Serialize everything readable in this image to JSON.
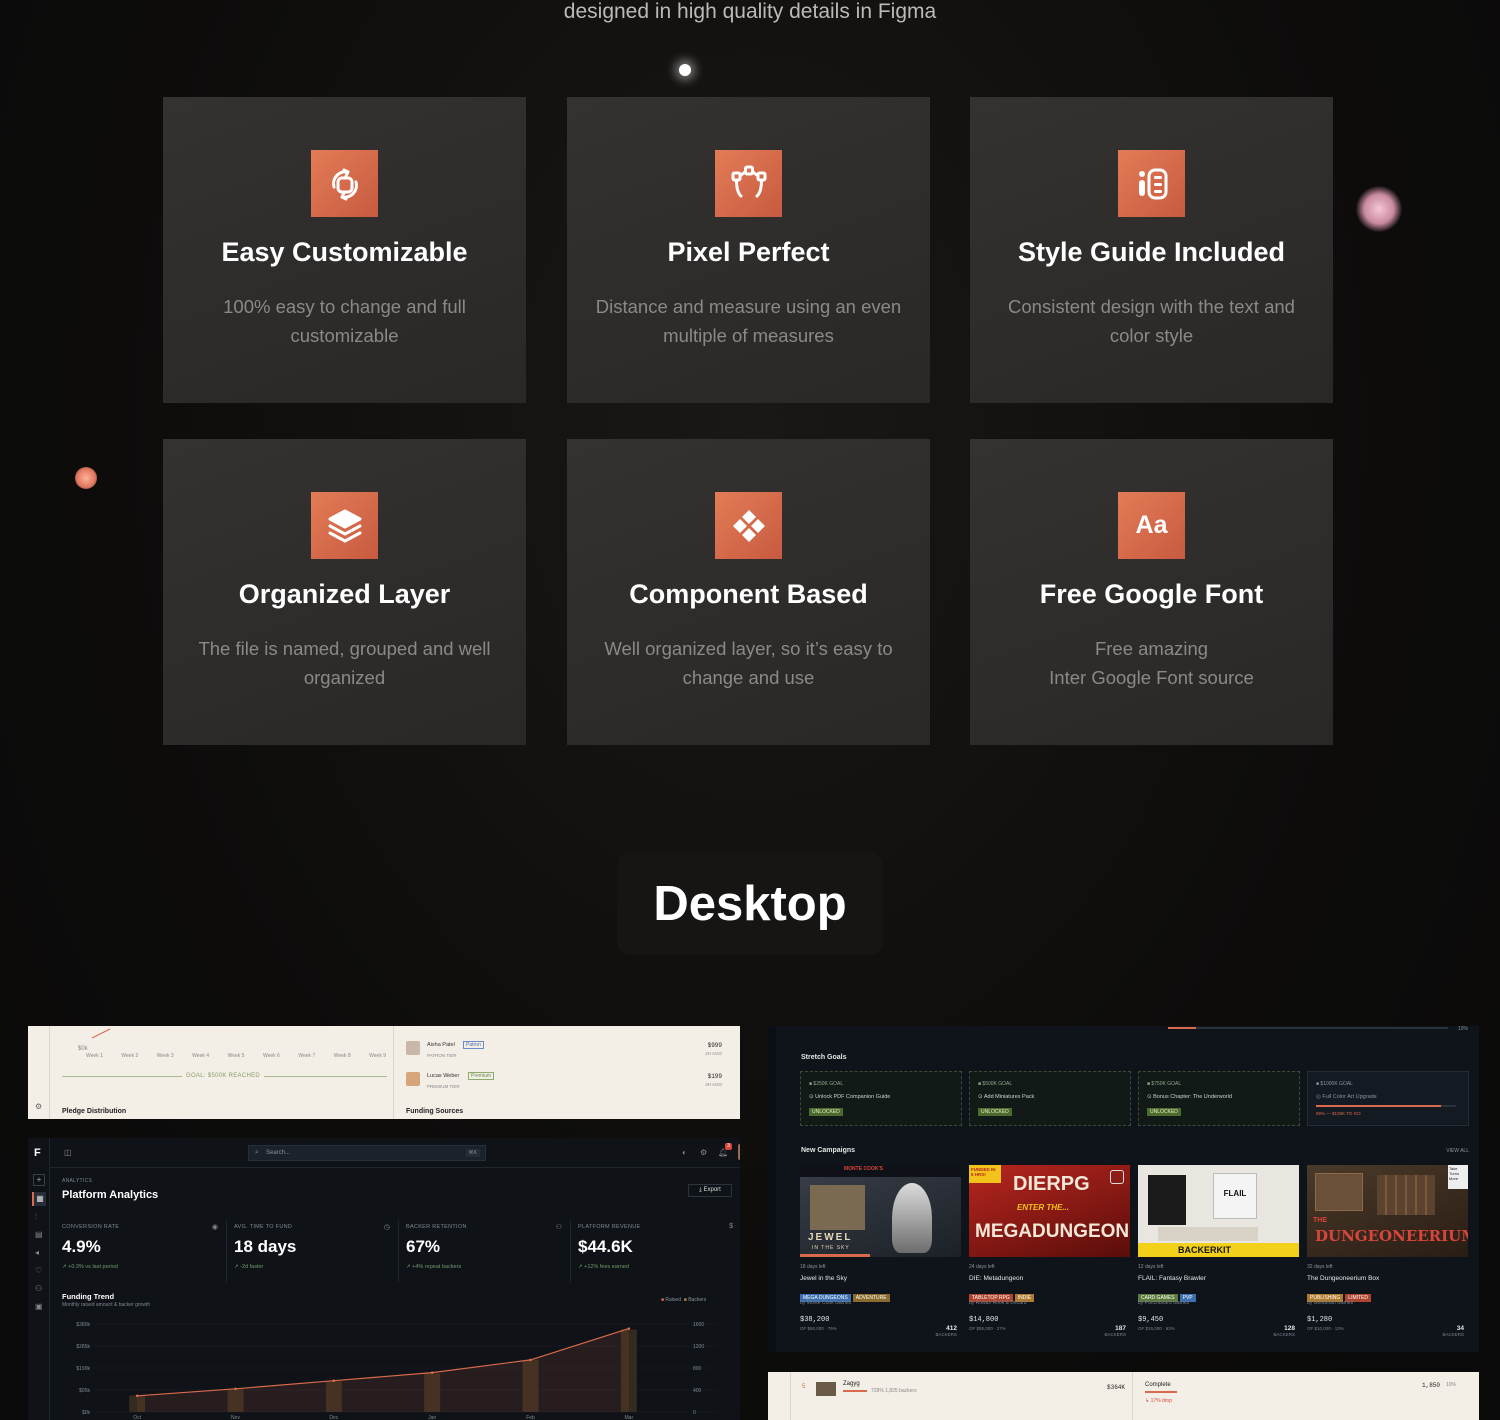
{
  "tagline": "designed in high quality details in Figma",
  "features": [
    {
      "icon": "rotate-shapes-icon",
      "title": "Easy Customizable",
      "desc": "100% easy to change and full customizable"
    },
    {
      "icon": "vector-pen-icon",
      "title": "Pixel Perfect",
      "desc": "Distance and measure using an even multiple of measures"
    },
    {
      "icon": "style-guide-icon",
      "title": "Style Guide Included",
      "desc": "Consistent design with the text and color style"
    },
    {
      "icon": "layers-icon",
      "title": "Organized Layer",
      "desc": "The file is named, grouped and well organized"
    },
    {
      "icon": "component-icon",
      "title": "Component Based",
      "desc": "Well organized layer, so it’s easy to change and use"
    },
    {
      "icon": "font-icon",
      "title": "Free Google Font",
      "desc1": "Free amazing",
      "desc2": "Inter Google Font source"
    }
  ],
  "font_icon_text": "Aa",
  "section_title": "Desktop",
  "colors": {
    "accent": "#d96a4c",
    "card": "#2f2d2b",
    "bg": "#0c0b0a"
  },
  "shot1": {
    "chart_axis_min": "$0k",
    "weeks": [
      "Week 1",
      "Week 2",
      "Week 3",
      "Week 4",
      "Week 5",
      "Week 6",
      "Week 7",
      "Week 8",
      "Week 9"
    ],
    "goal_label": "GOAL: $500K REACHED",
    "pledge_title": "Pledge Distribution",
    "funding_title": "Funding Sources",
    "backers": [
      {
        "name": "Aisha Patel",
        "badge": "Patron",
        "tier": "PATRON TIER",
        "amount": "$999",
        "ago": "2H AGO"
      },
      {
        "name": "Lucas Weber",
        "badge": "Premium",
        "tier": "PREMIUM TIER",
        "amount": "$199",
        "ago": "3H AGO"
      }
    ]
  },
  "shot2": {
    "logo": "F",
    "search_placeholder": "Search...",
    "shortcut": "⌘K",
    "notif_count": "3",
    "eyebrow": "ANALYTICS",
    "title": "Platform Analytics",
    "export": "Export",
    "kpis": [
      {
        "label": "CONVERSION RATE",
        "value": "4.9%",
        "delta": "↗ +0.3%  vs last period"
      },
      {
        "label": "AVG. TIME TO FUND",
        "value": "18 days",
        "delta": "↗ -2d  faster"
      },
      {
        "label": "BACKER RETENTION",
        "value": "67%",
        "delta": "↗ +4%  repeat backers"
      },
      {
        "label": "PLATFORM REVENUE",
        "value": "$44.6K",
        "delta": "↗ +12%  fees earned"
      }
    ],
    "trend_title": "Funding Trend",
    "trend_sub": "Monthly raised amount & backer growth",
    "legend_raised": "Raised",
    "legend_backers": "Backers"
  },
  "chart_data": {
    "type": "bar",
    "title": "Funding Trend",
    "categories": [
      "Oct",
      "Nov",
      "Dec",
      "Jan",
      "Feb",
      "Mar"
    ],
    "y_left_ticks": [
      "$380k",
      "$285k",
      "$190k",
      "$95k",
      "$0k"
    ],
    "y_right_ticks": [
      "1600",
      "1200",
      "800",
      "400",
      "0"
    ],
    "ylim": [
      0,
      380
    ],
    "series": [
      {
        "name": "Raised",
        "values": [
          70,
          100,
          135,
          170,
          225,
          360
        ]
      },
      {
        "name": "Backers",
        "values": [
          300,
          420,
          560,
          700,
          950,
          1500
        ]
      }
    ]
  },
  "shot3": {
    "progress_pct": "10%",
    "stretch_title": "Stretch Goals",
    "stretch": [
      {
        "goal": "$250K GOAL",
        "name": "Unlock PDF Companion Guide",
        "status": "UNLOCKED"
      },
      {
        "goal": "$500K GOAL",
        "name": "Add Miniatures Pack",
        "status": "UNLOCKED"
      },
      {
        "goal": "$750K GOAL",
        "name": "Bonus Chapter: The Underworld",
        "status": "UNLOCKED"
      },
      {
        "goal": "$1000K GOAL",
        "name": "Full Color Art Upgrade",
        "status": "89% — $108K TO GO",
        "progress": 0.89
      }
    ],
    "new_title": "New Campaigns",
    "view_all": "VIEW ALL",
    "campaigns": [
      {
        "days": "18 days left",
        "name": "Jewel in the Sky",
        "tags": [
          "MEGA DUNGEONS",
          "ADVENTURE"
        ],
        "tag_colors": [
          "#3b6fb0",
          "#8a6a2d"
        ],
        "by": "by Monte Cook Games",
        "raised": "$38,200",
        "goal": "OF $50,000 · 76%",
        "backers": "412",
        "backers_label": "BACKERS",
        "art": [
          "MONTE COOK'S",
          "JEWEL",
          "IN THE SKY"
        ]
      },
      {
        "days": "24 days left",
        "name": "DIE: Metadungeon",
        "tags": [
          "TABLETOP RPG",
          "INDIE"
        ],
        "tag_colors": [
          "#b0452f",
          "#b07a2d"
        ],
        "by": "by Rowan Rook & Decard",
        "raised": "$14,800",
        "goal": "OF $55,000 · 27%",
        "backers": "187",
        "backers_label": "BACKERS",
        "art": [
          "FUNDED IN 6 HRS!",
          "DIERPG",
          "ENTER THE...",
          "MEGADUNGEON"
        ]
      },
      {
        "days": "12 days left",
        "name": "FLAIL: Fantasy Brawler",
        "tags": [
          "CARD GAMES",
          "PVP"
        ],
        "tag_colors": [
          "#5a7a3b",
          "#3b6fb0"
        ],
        "by": "by Punchboard Games",
        "raised": "$9,450",
        "goal": "OF $15,000 · 63%",
        "backers": "128",
        "backers_label": "BACKERS",
        "art": [
          "FLAIL",
          "BACKERKIT"
        ]
      },
      {
        "days": "32 days left",
        "name": "The Dungeoneerium Box",
        "tags": [
          "PUBLISHING",
          "LIMITED"
        ],
        "tag_colors": [
          "#b07a2d",
          "#b0452f"
        ],
        "by": "by Goodman Games",
        "raised": "$1,280",
        "goal": "OF $10,000 · 13%",
        "backers": "34",
        "backers_label": "BACKERS",
        "art": [
          "THE",
          "DUNGEONEERIUM",
          "Take Turns More"
        ]
      }
    ]
  },
  "shot4": {
    "rank": "5",
    "name": "Zagyg",
    "stats": "728%  1,825 backers",
    "amount": "$364K",
    "status": "Complete",
    "status_sub": "↳ 17% drop",
    "right_value": "1,850",
    "right_pct": "10%"
  }
}
